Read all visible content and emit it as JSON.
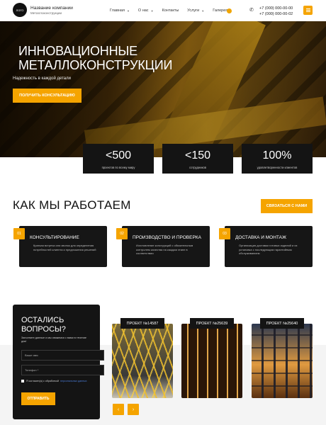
{
  "header": {
    "logo_text": "ЛОГО",
    "company_name": "Название компании",
    "company_sub": "Металлоконструкции",
    "nav": [
      {
        "label": "Главная",
        "has_dropdown": true
      },
      {
        "label": "О нас",
        "has_dropdown": true
      },
      {
        "label": "Контакты",
        "has_dropdown": false
      },
      {
        "label": "Услуги",
        "has_dropdown": true
      },
      {
        "label": "Галерея",
        "has_dropdown": false
      }
    ],
    "phones": [
      "+7 (000) 000-00-00",
      "+7 (000) 000-00-02"
    ]
  },
  "hero": {
    "title_line1": "ИННОВАЦИОННЫЕ",
    "title_line2": "МЕТАЛЛОКОНСТРУКЦИИ",
    "subtitle": "Надежность в каждой детали",
    "cta": "ПОЛУЧИТЬ КОНСУЛЬТАЦИЮ"
  },
  "stats": [
    {
      "value": "<500",
      "label": "проектов по всему миру"
    },
    {
      "value": "<150",
      "label": "сотрудников"
    },
    {
      "value": "100%",
      "label": "удовлетворенности клиентов"
    }
  ],
  "how": {
    "title": "КАК МЫ РАБОТАЕМ",
    "contact_button": "СВЯЗАТЬСЯ С НАМИ",
    "steps": [
      {
        "num": "01",
        "title": "КОНСУЛЬТИРОВАНИЕ",
        "desc": "Краткая встреча или звонок для определения потребностей клиента и предложения решений"
      },
      {
        "num": "02",
        "title": "ПРОИЗВОДСТВО И ПРОВЕРКА",
        "desc": "Изготовление конструкций с обязательным контролем качества на каждом этапе в соответствии"
      },
      {
        "num": "03",
        "title": "ДОСТАВКА И МОНТАЖ",
        "desc": "Организация доставки готовых изделий и их установка с последующим гарантийным обслуживанием"
      }
    ]
  },
  "form": {
    "title_line1": "ОСТАЛИСЬ",
    "title_line2": "ВОПРОСЫ?",
    "subtitle": "Заполните данные и мы свяжемся с вами в течение дня!",
    "name_placeholder": "Ваше имя",
    "phone_placeholder": "Телефон *",
    "agree_text": "Я согласен(а) с обработкой",
    "agree_link": "персональных данных",
    "submit": "ОТПРАВИТЬ"
  },
  "projects": [
    {
      "label": "ПРОЕКТ №14587"
    },
    {
      "label": "ПРОЕКТ №25639"
    },
    {
      "label": "ПРОЕКТ №25640"
    }
  ],
  "colors": {
    "accent": "#f5a400",
    "dark": "#141414"
  }
}
